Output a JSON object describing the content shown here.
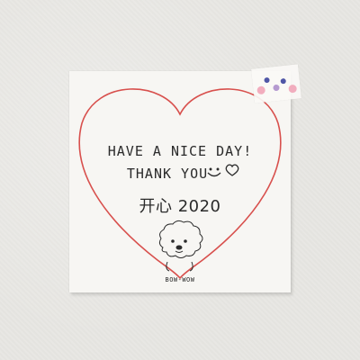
{
  "card": {
    "line1": "HAVE A NICE DAY!",
    "line2": "THANK YOU",
    "line3": "开心 2020",
    "dog_label": "BOW-WOW"
  },
  "colors": {
    "heart_outline": "#d8504d",
    "ink": "#2b2b2b",
    "sticker_blue": "#4f56a6",
    "sticker_pink": "#f0a0b4",
    "sticker_lilac": "#b59ad0"
  },
  "icons": [
    "heart-outline",
    "smiley-face-icon",
    "small-heart-icon",
    "poodle-dog-drawing",
    "face-sticker"
  ]
}
